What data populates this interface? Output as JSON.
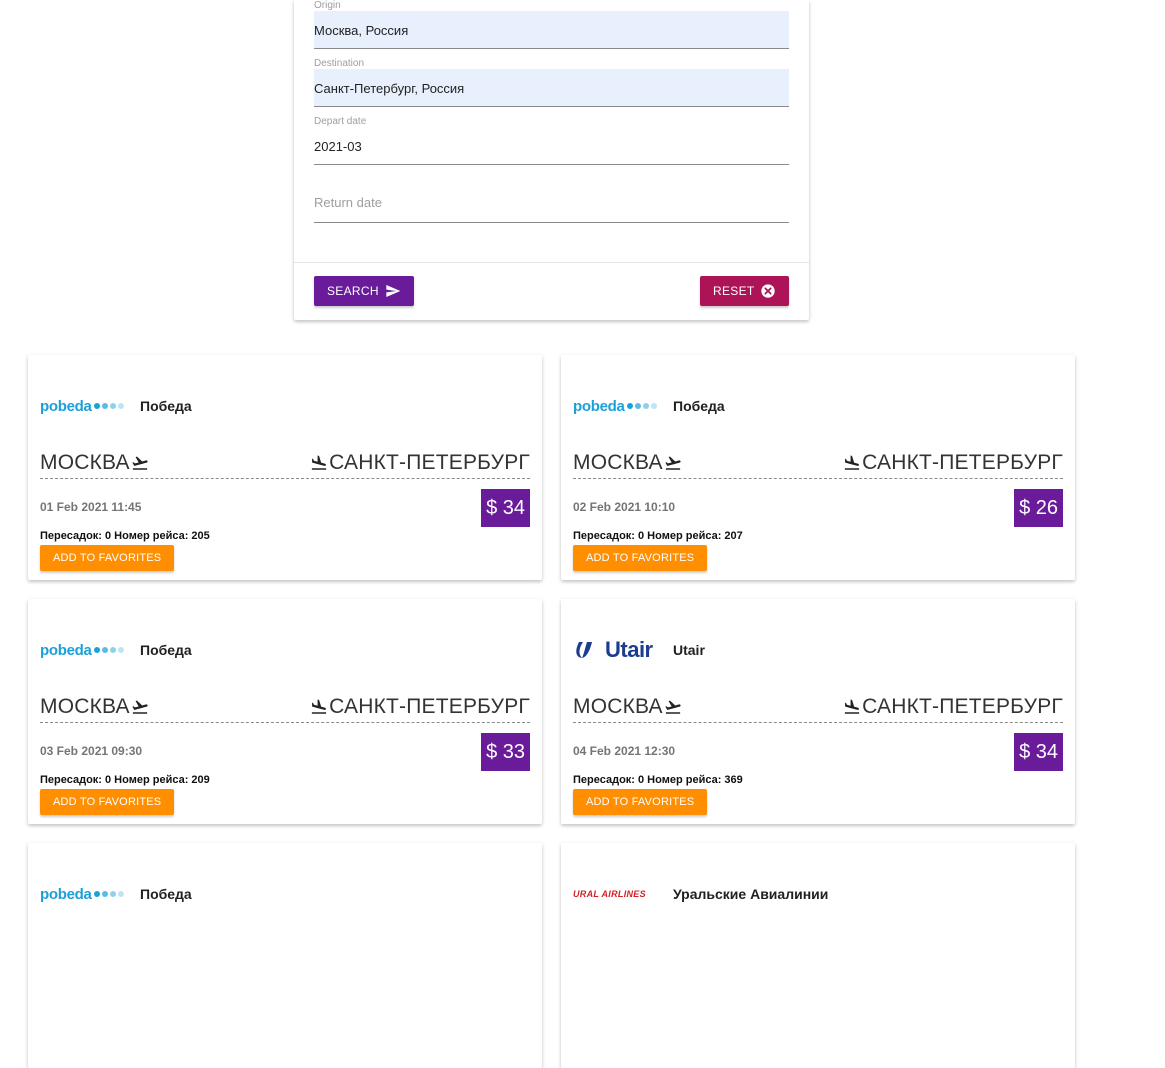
{
  "search_form": {
    "origin": {
      "label": "Origin",
      "value": "Москва, Россия"
    },
    "destination": {
      "label": "Destination",
      "value": "Санкт-Петербург, Россия"
    },
    "depart_date": {
      "label": "Depart date",
      "value": "2021-03"
    },
    "return_date": {
      "placeholder": "Return date"
    },
    "search_label": "SEARCH",
    "reset_label": "RESET"
  },
  "colors": {
    "primary": "#6a1b9a",
    "reset": "#ad1457",
    "favorite": "#ff8f00",
    "pobeda": "#1ba1d9",
    "utair": "#1c3d8f",
    "ural": "#d32027"
  },
  "tickets": [
    {
      "logo": "pobeda",
      "logo_text": "pobeda",
      "airline": "Победа",
      "from": "МОСКВА",
      "to": "САНКТ-ПЕТЕРБУРГ",
      "date": "01 Feb 2021 11:45",
      "price": "$ 34",
      "info": "Пересадок: 0 Номер рейса: 205",
      "fav_label": "ADD TO FAVORITES"
    },
    {
      "logo": "pobeda",
      "logo_text": "pobeda",
      "airline": "Победа",
      "from": "МОСКВА",
      "to": "САНКТ-ПЕТЕРБУРГ",
      "date": "02 Feb 2021 10:10",
      "price": "$ 26",
      "info": "Пересадок: 0 Номер рейса: 207",
      "fav_label": "ADD TO FAVORITES"
    },
    {
      "logo": "pobeda",
      "logo_text": "pobeda",
      "airline": "Победа",
      "from": "МОСКВА",
      "to": "САНКТ-ПЕТЕРБУРГ",
      "date": "03 Feb 2021 09:30",
      "price": "$ 33",
      "info": "Пересадок: 0 Номер рейса: 209",
      "fav_label": "ADD TO FAVORITES"
    },
    {
      "logo": "utair",
      "logo_text": "Utair",
      "airline": "Utair",
      "from": "МОСКВА",
      "to": "САНКТ-ПЕТЕРБУРГ",
      "date": "04 Feb 2021 12:30",
      "price": "$ 34",
      "info": "Пересадок: 0 Номер рейса: 369",
      "fav_label": "ADD TO FAVORITES"
    },
    {
      "logo": "pobeda",
      "logo_text": "pobeda",
      "airline": "Победа"
    },
    {
      "logo": "ural",
      "logo_text": "URAL AIRLINES",
      "airline": "Уральские Авиалинии"
    }
  ]
}
